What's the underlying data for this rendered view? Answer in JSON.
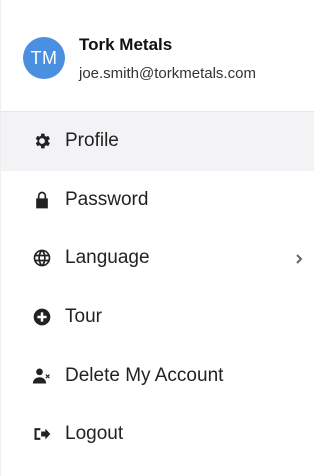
{
  "account": {
    "initials": "TM",
    "name": "Tork Metals",
    "email": "joe.smith@torkmetals.com",
    "avatar_color": "#4a8fe0"
  },
  "menu": {
    "items": [
      {
        "label": "Profile",
        "icon": "gear-icon",
        "active": true
      },
      {
        "label": "Password",
        "icon": "lock-icon"
      },
      {
        "label": "Language",
        "icon": "globe-icon",
        "submenu": true
      },
      {
        "label": "Tour",
        "icon": "tour-icon"
      },
      {
        "label": "Delete My Account",
        "icon": "user-delete-icon"
      },
      {
        "label": "Logout",
        "icon": "logout-icon"
      }
    ]
  },
  "colors": {
    "active_bg": "#f3f3f6",
    "text": "#222222"
  }
}
